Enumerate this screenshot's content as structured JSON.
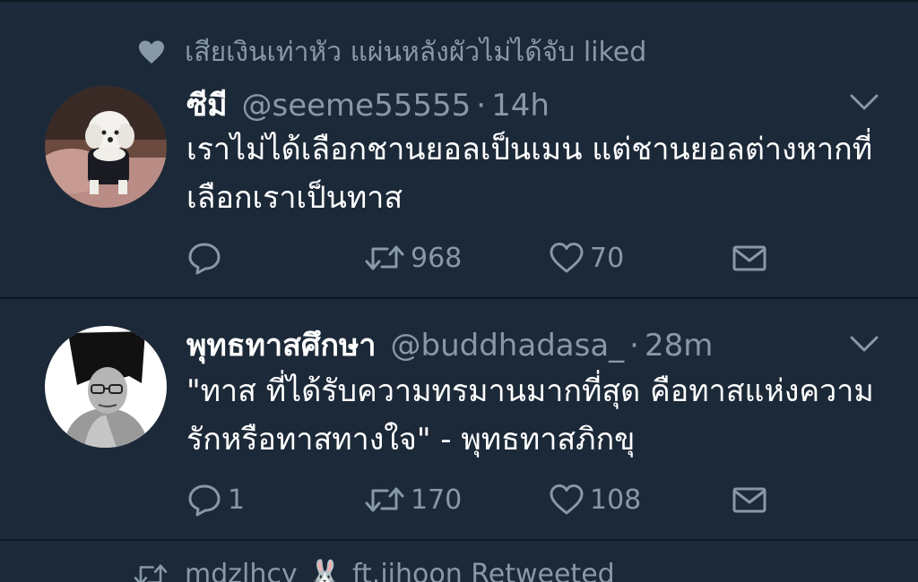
{
  "social_context": {
    "icon": "heart-icon",
    "text": "เสียเงินเท่าหัว แผ่นหลังผัวไม่ได้จับ liked"
  },
  "tweets": [
    {
      "name": "ซีมี",
      "handle": "@seeme55555",
      "separator": "·",
      "time": "14h",
      "text": "เราไม่ได้เลือกชานยอลเป็นเมน แต่ชานยอลต่างหากที่เลือกเราเป็นทาส",
      "actions": {
        "reply_count": "",
        "retweet_count": "968",
        "like_count": "70"
      }
    },
    {
      "name": "พุทธทาสศึกษา",
      "handle": "@buddhadasa_",
      "separator": "·",
      "time": "28m",
      "text": "\"ทาส ที่ได้รับความทรมานมากที่สุด คือทาสแห่งความรักหรือทาสทางใจ\" - พุทธทาสภิกขุ",
      "actions": {
        "reply_count": "1",
        "retweet_count": "170",
        "like_count": "108"
      }
    }
  ],
  "next_social_context": {
    "icon": "retweet-icon",
    "user": "mdzlhcy",
    "emoji": "🐰",
    "text": "ft.jihoon Retweeted"
  },
  "colors": {
    "background": "#1c2938",
    "separator": "#0f1721",
    "primary_text": "#ffffff",
    "secondary_text": "#8899a6"
  }
}
